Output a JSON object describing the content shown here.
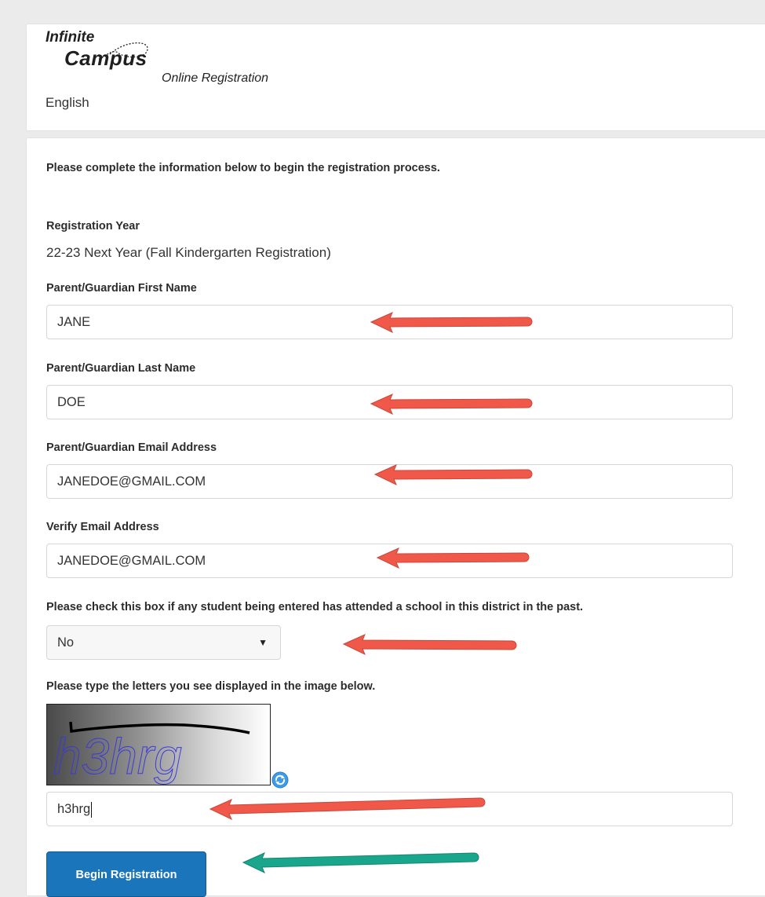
{
  "header": {
    "logo_word1": "Infinite",
    "logo_word2": "Campus",
    "logo_subtitle": "Online Registration",
    "language": "English"
  },
  "form": {
    "intro": "Please complete the information below to begin the registration process.",
    "registration_year": {
      "label": "Registration Year",
      "value": "22-23 Next Year (Fall Kindergarten Registration)"
    },
    "first_name": {
      "label": "Parent/Guardian First Name",
      "value": "JANE"
    },
    "last_name": {
      "label": "Parent/Guardian Last Name",
      "value": "DOE"
    },
    "email": {
      "label": "Parent/Guardian Email Address",
      "value": "JANEDOE@GMAIL.COM"
    },
    "verify_email": {
      "label": "Verify Email Address",
      "value": "JANEDOE@GMAIL.COM"
    },
    "attended": {
      "label": "Please check this box if any student being entered has attended a school in this district in the past.",
      "selected": "No"
    },
    "captcha": {
      "label": "Please type the letters you see displayed in the image below.",
      "image_text": "h3hrg",
      "value": "h3hrg"
    },
    "submit_label": "Begin Registration"
  },
  "annotations": {
    "arrow_color_red": "#f0584a",
    "arrow_color_teal": "#1aa58d"
  },
  "colors": {
    "primary_button": "#1b75bb",
    "page_background": "#ebebeb"
  }
}
